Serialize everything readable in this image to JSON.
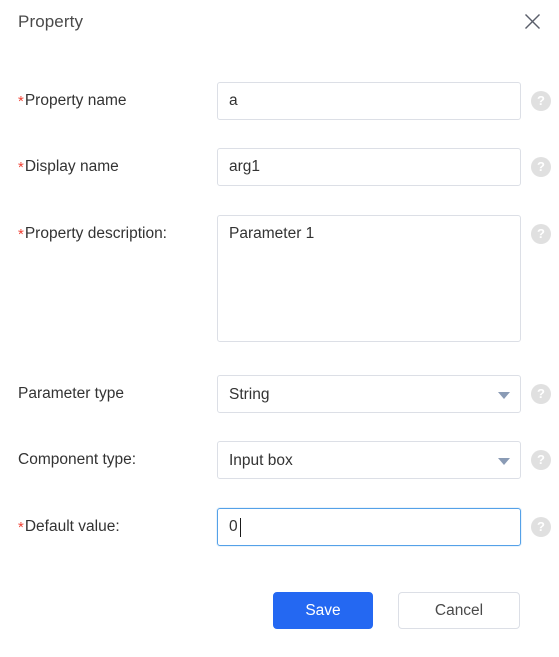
{
  "dialog": {
    "title": "Property",
    "close_icon": "close-icon"
  },
  "fields": [
    {
      "label": "Property name",
      "required": true,
      "type": "input",
      "value": "a",
      "placeholder": "",
      "help_icon": "help-icon"
    },
    {
      "label": "Display name",
      "required": true,
      "type": "input",
      "value": "arg1",
      "placeholder": "",
      "help_icon": "help-icon"
    },
    {
      "label": "Property description:",
      "required": true,
      "type": "textarea",
      "value": "Parameter 1",
      "placeholder": "",
      "help_icon": "help-icon"
    },
    {
      "label": "Parameter type",
      "required": false,
      "type": "select",
      "value": "String",
      "help_icon": "help-icon"
    },
    {
      "label": "Component type:",
      "required": false,
      "type": "select",
      "value": "Input box",
      "help_icon": "help-icon"
    },
    {
      "label": "Default value:",
      "required": true,
      "type": "input",
      "value": "0",
      "placeholder": "",
      "focused": true,
      "help_icon": "help-icon"
    }
  ],
  "footer": {
    "save_label": "Save",
    "cancel_label": "Cancel"
  },
  "colors": {
    "primary": "#2468f2",
    "required_star": "#f04134",
    "focus_border": "#55a1e8",
    "border": "#dcdfe6",
    "help_bg": "#e0e0e0"
  },
  "marks": {
    "asterisk": "*",
    "question": "?"
  }
}
